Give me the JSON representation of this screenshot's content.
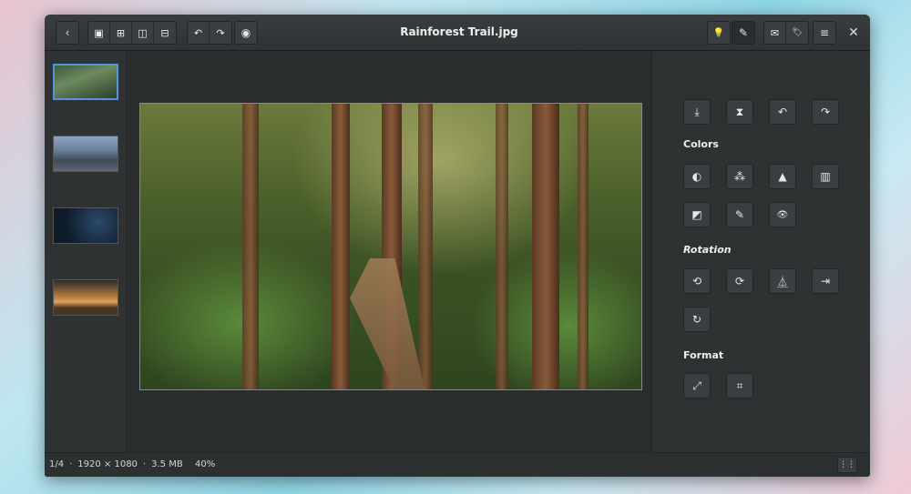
{
  "window": {
    "title": "Rainforest Trail.jpg"
  },
  "headerbar": {
    "back_icon": "‹",
    "view_modes": [
      "▣",
      "⊞",
      "◫",
      "⊟"
    ],
    "rotate_left": "↶",
    "rotate_right": "↷",
    "stamp_icon": "◉",
    "light_icon": "💡",
    "edit_icon": "✎",
    "comment_icon": "✉",
    "tag_icon": "🏷",
    "menu_icon": "≡",
    "close_icon": "✕"
  },
  "thumbnails": [
    {
      "name": "rainforest",
      "active": true
    },
    {
      "name": "city",
      "active": false
    },
    {
      "name": "night",
      "active": false
    },
    {
      "name": "sunset",
      "active": false
    }
  ],
  "sidebar": {
    "top_tools": [
      "⤓",
      "⧗",
      "↶",
      "↷"
    ],
    "colors_label": "Colors",
    "colors_tools_row1": [
      "◐",
      "⁂",
      "▲",
      "▥"
    ],
    "colors_tools_row2": [
      "◩",
      "✎",
      "👁"
    ],
    "rotation_label": "Rotation",
    "rotation_tools_row1": [
      "⟲",
      "⟳",
      "⏅",
      "⇥"
    ],
    "rotation_tools_row2": [
      "↻"
    ],
    "format_label": "Format",
    "format_tools": [
      "⤢",
      "⌗"
    ]
  },
  "status": {
    "position": "1/4",
    "separator": "·",
    "dimensions": "1920 × 1080",
    "size": "3.5 MB",
    "zoom": "40%",
    "grid_icon": "⋮⋮"
  }
}
